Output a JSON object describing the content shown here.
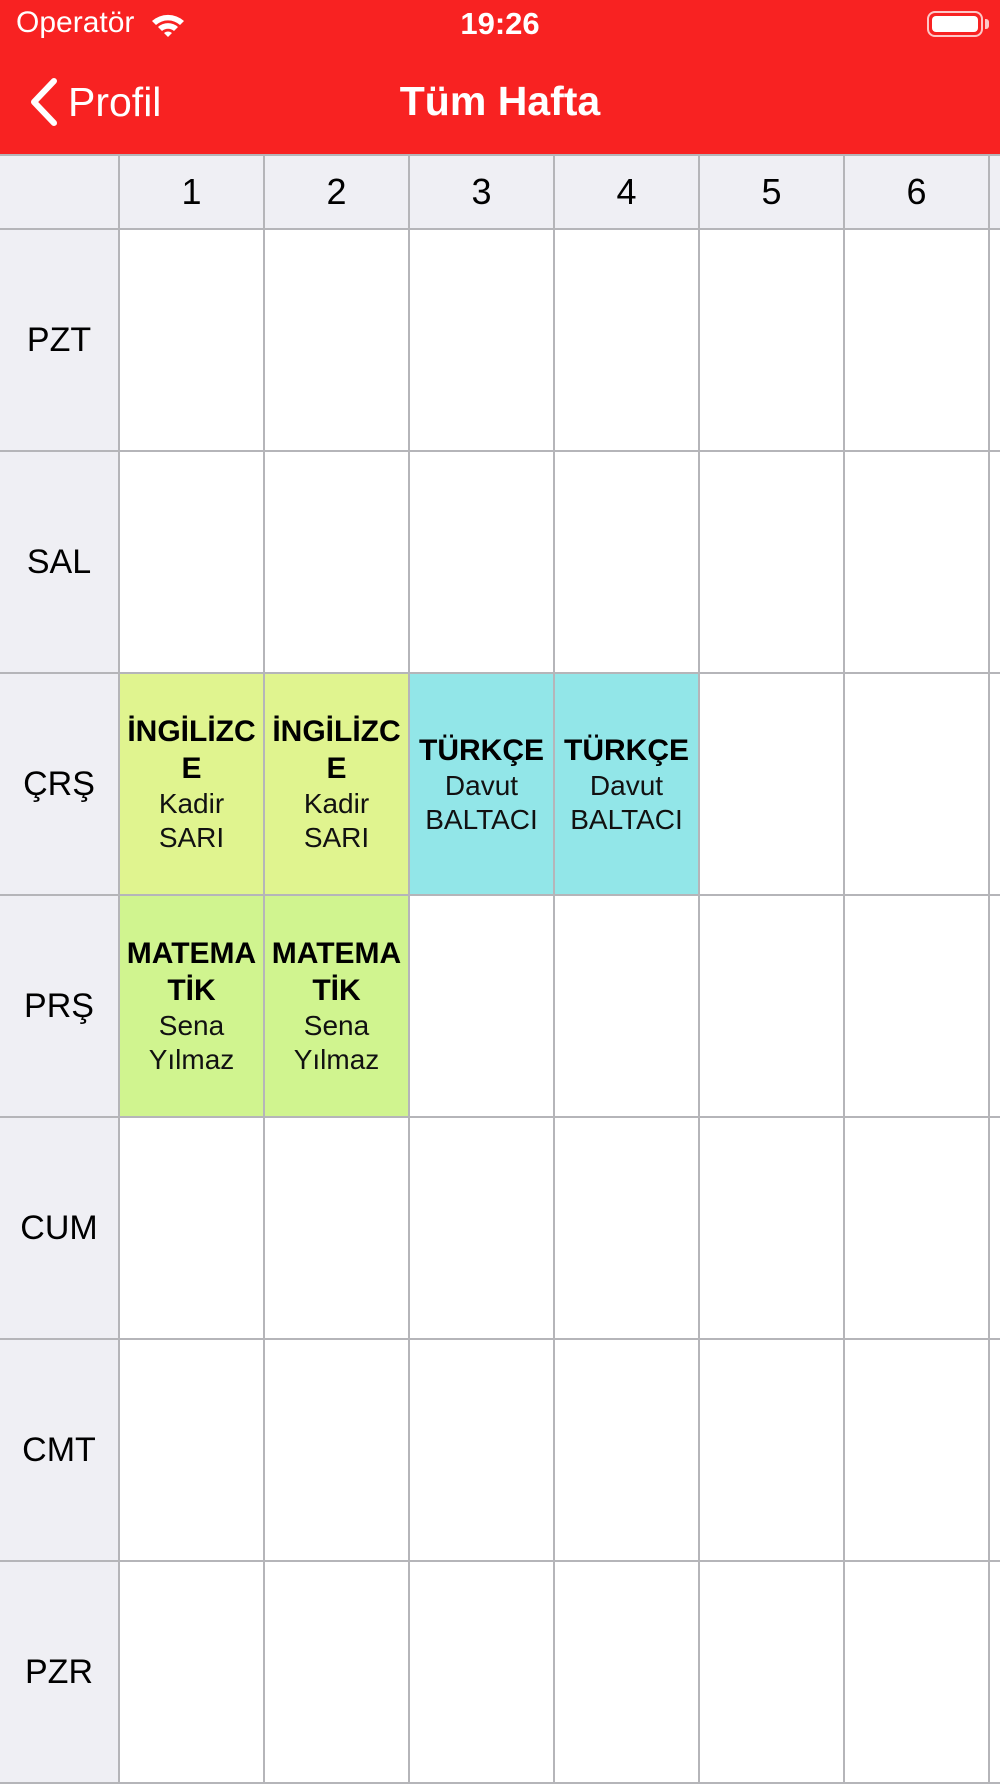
{
  "status_bar": {
    "carrier": "Operatör",
    "time": "19:26"
  },
  "nav": {
    "back_label": "Profil",
    "title": "Tüm Hafta"
  },
  "periods": [
    "1",
    "2",
    "3",
    "4",
    "5",
    "6"
  ],
  "days": [
    "PZT",
    "SAL",
    "ÇRŞ",
    "PRŞ",
    "CUM",
    "CMT",
    "PZR"
  ],
  "colors": {
    "nav_bar": "#f82222",
    "ingilizce": "#e0f48f",
    "turkce": "#92e6e8",
    "matematik": "#d0f48f"
  },
  "lessons": {
    "cars_1": {
      "course": "İNGİLİZCE",
      "teacher": "Kadir SARI"
    },
    "cars_2": {
      "course": "İNGİLİZCE",
      "teacher": "Kadir SARI"
    },
    "cars_3": {
      "course": "TÜRKÇE",
      "teacher": "Davut BALTACI"
    },
    "cars_4": {
      "course": "TÜRKÇE",
      "teacher": "Davut BALTACI"
    },
    "pers_1": {
      "course": "MATEMATİK",
      "teacher": "Sena Yılmaz"
    },
    "pers_2": {
      "course": "MATEMATİK",
      "teacher": "Sena Yılmaz"
    }
  }
}
